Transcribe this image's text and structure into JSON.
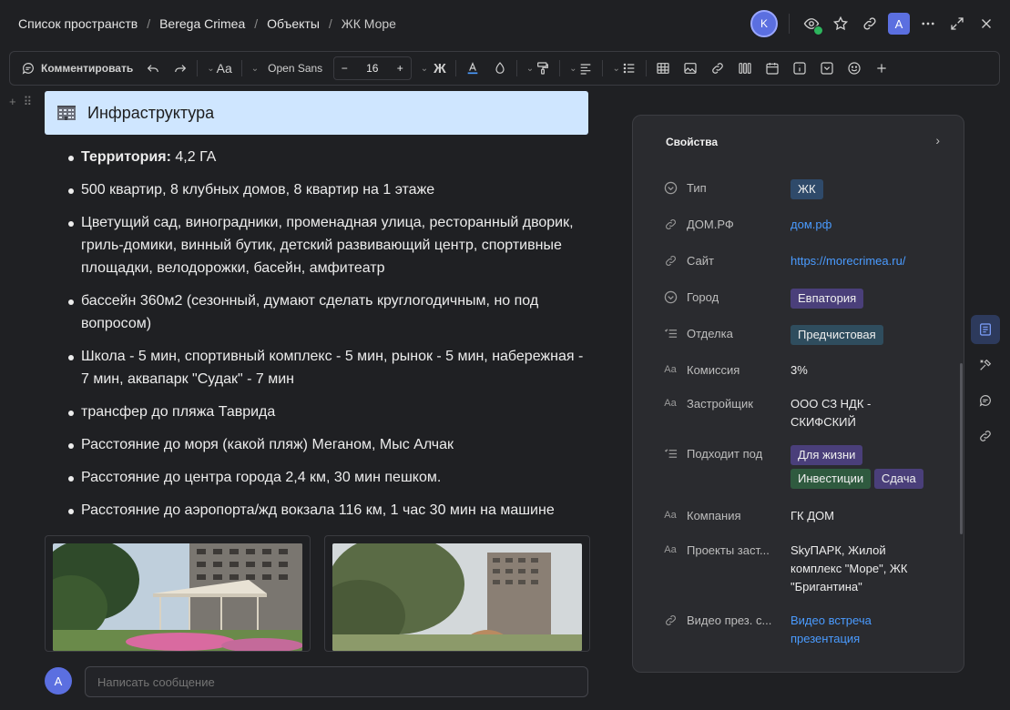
{
  "breadcrumbs": [
    "Список пространств",
    "Berega Crimea",
    "Объекты",
    "ЖК Море"
  ],
  "header": {
    "user_initial": "K",
    "account_initial": "A"
  },
  "toolbar": {
    "comment_label": "Комментировать",
    "font_family": "Open Sans",
    "font_size": "16",
    "bold_label": "Ж",
    "minus": "−",
    "plus": "+"
  },
  "heading": {
    "title": "Инфраструктура"
  },
  "bullets": {
    "territory_label": "Территория:",
    "territory_value": " 4,2 ГА",
    "items": [
      "500 квартир, 8 клубных домов, 8 квартир на 1 этаже",
      "Цветущий сад, виноградники, променадная улица, ресторанный дворик, гриль-домики, винный бутик, детский развивающий центр, спортивные площадки, велодорожки, басейн, амфитеатр",
      "бассейн 360м2 (сезонный, думают сделать круглогодичным, но под вопросом)",
      "Школа - 5 мин, спортивный комплекс - 5 мин, рынок - 5 мин, набережная - 7 мин, аквапарк \"Судак\" - 7 мин",
      "трансфер до пляжа Таврида",
      "Расстояние до моря (какой пляж) Меганом, Мыс Алчак",
      "Расстояние до центра города 2,4 км, 30 мин пешком.",
      "Расстояние до аэропорта/жд вокзала 116 км, 1 час 30 мин на машине"
    ]
  },
  "message": {
    "avatar": "A",
    "placeholder": "Написать сообщение"
  },
  "properties": {
    "title": "Свойства",
    "rows": [
      {
        "label": "Тип",
        "icon": "dropdown-icon",
        "tags": [
          "ЖК"
        ]
      },
      {
        "label": "ДОМ.РФ",
        "icon": "link-icon",
        "link": "дом.рф"
      },
      {
        "label": "Сайт",
        "icon": "link-icon",
        "link": "https://morecrimea.ru/"
      },
      {
        "label": "Город",
        "icon": "dropdown-icon",
        "tags": [
          "Евпатория"
        ]
      },
      {
        "label": "Отделка",
        "icon": "multiselect-icon",
        "tags": [
          "Предчистовая"
        ]
      },
      {
        "label": "Комиссия",
        "icon": "text-icon",
        "text": "3%"
      },
      {
        "label": "Застройщик",
        "icon": "text-icon",
        "text": "ООО СЗ НДК - СКИФСКИЙ"
      },
      {
        "label": "Подходит под",
        "icon": "multiselect-icon",
        "tags": [
          "Для жизни",
          "Инвестиции",
          "Сдача"
        ]
      },
      {
        "label": "Компания",
        "icon": "text-icon",
        "text": "ГК ДОМ"
      },
      {
        "label": "Проекты заст...",
        "icon": "text-icon",
        "text": "SkyПАРК, Жилой комплекс \"Море\", ЖК \"Бригантина\""
      },
      {
        "label": "Видео през. с...",
        "icon": "link-icon",
        "link": "Видео встреча презентация"
      }
    ]
  },
  "colors": {
    "accent": "#5b6fe0",
    "link": "#4a9bff",
    "heading_bg": "#cfe6ff",
    "panel_bg": "#2a2b2f"
  }
}
